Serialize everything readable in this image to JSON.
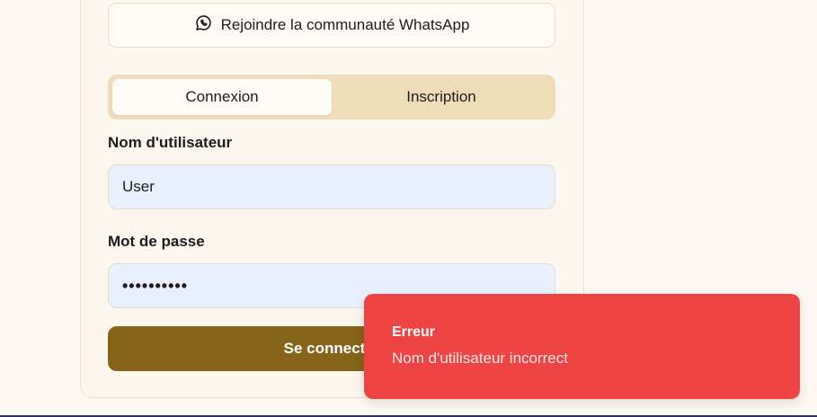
{
  "whatsapp": {
    "label": "Rejoindre la communauté WhatsApp",
    "icon": "whatsapp-icon"
  },
  "tabs": [
    {
      "label": "Connexion",
      "active": true
    },
    {
      "label": "Inscription",
      "active": false
    }
  ],
  "form": {
    "username_label": "Nom d'utilisateur",
    "username_value": "User",
    "password_label": "Mot de passe",
    "password_value": "••••••••••",
    "submit_label": "Se connecter"
  },
  "toast": {
    "title": "Erreur",
    "message": "Nom d'utilisateur incorrect"
  },
  "colors": {
    "background": "#fcf8f1",
    "tabs_bg": "#efdcb9",
    "input_bg": "#e8f0fe",
    "submit": "#846519",
    "toast": "#ef4444"
  }
}
